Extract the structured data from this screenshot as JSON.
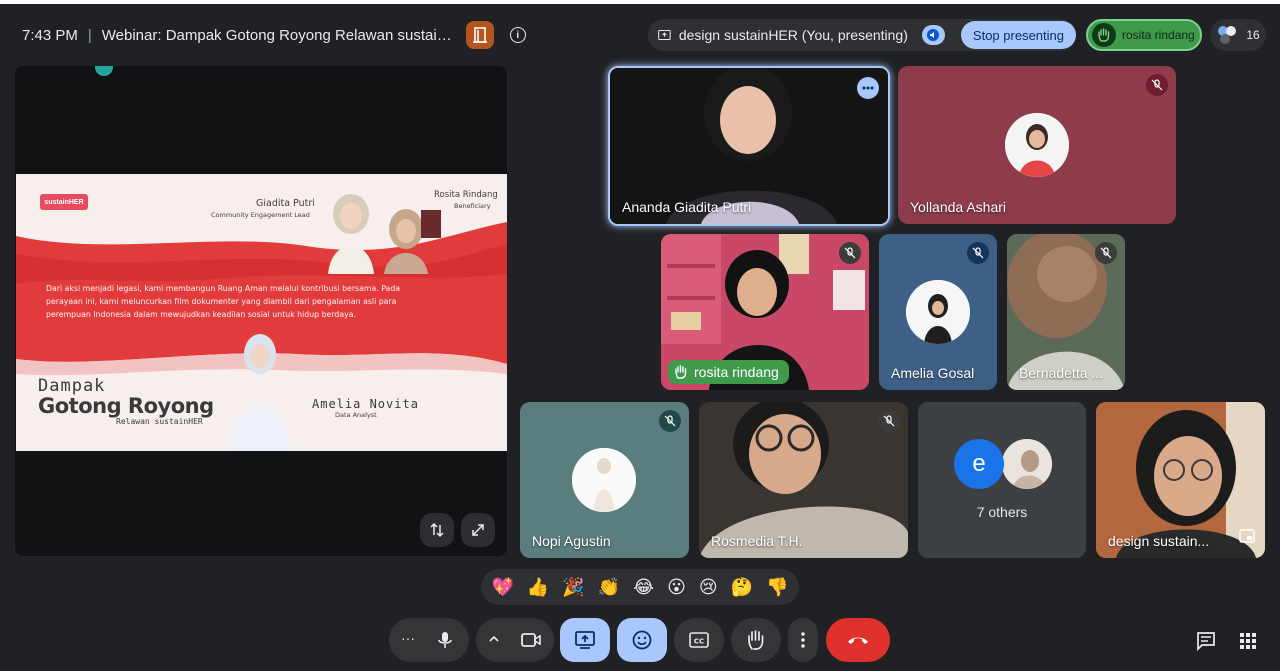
{
  "header": {
    "time": "7:43 PM",
    "separator": "|",
    "meeting_title": "Webinar: Dampak Gotong Royong Relawan sustain...",
    "info_label": "i"
  },
  "presenting": {
    "label": "design sustainHER (You, presenting)",
    "stop_button": "Stop presenting"
  },
  "hand_raised": {
    "name": "rosita rindang"
  },
  "participants_count": "16",
  "slide": {
    "logo": "sustainHER",
    "person1_name": "Giadita Putri",
    "person1_role": "Community Engagement Lead",
    "person2_name": "Rosita Rindang",
    "person2_role": "Beneficiary",
    "body_line1": "Dari aksi menjadi legasi, kami membangun Ruang Aman melalui kontribusi bersama. Pada",
    "body_line2": "perayaan ini, kami meluncurkan film dokumenter yang diambil dari pengalaman asli para",
    "body_line3": "perempuan Indonesia dalam mewujudkan keadilan sosial untuk hidup berdaya.",
    "title_line1": "Dampak",
    "title_line2": "Gotong Royong",
    "title_line3": "Relawan sustainHER",
    "person3_name": "Amelia Novita",
    "person3_role": "Data Analyst"
  },
  "tiles": {
    "t1": "Ananda Giadita Putri",
    "t2": "Yollanda Ashari",
    "t3": "rosita rindang",
    "t4": "Amelia Gosal",
    "t5": "Bernadetta ...",
    "t6": "Nopi Agustin",
    "t7": "Rosmedia T.H.",
    "t8": "7 others",
    "t8_initial": "e",
    "t9": "design sustain..."
  },
  "reactions": [
    "💖",
    "👍",
    "🎉",
    "👏",
    "😂",
    "😮",
    "😢",
    "🤔",
    "👎"
  ],
  "controls": {
    "more_dots": "···"
  },
  "colors": {
    "background": "#202124",
    "accent_blue": "#a8c7fa",
    "end_call_red": "#e0322c",
    "hand_green": "#3f9a4c"
  }
}
